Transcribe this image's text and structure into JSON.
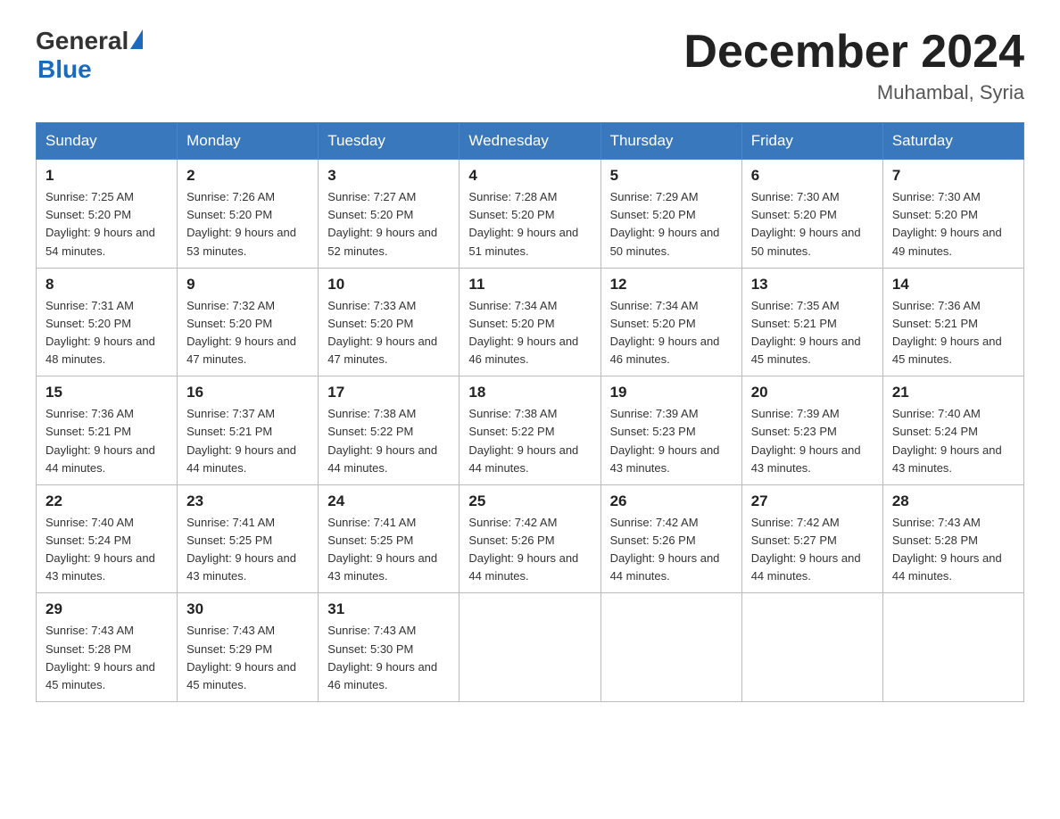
{
  "header": {
    "logo_general": "General",
    "logo_blue": "Blue",
    "month_year": "December 2024",
    "location": "Muhambal, Syria"
  },
  "days_of_week": [
    "Sunday",
    "Monday",
    "Tuesday",
    "Wednesday",
    "Thursday",
    "Friday",
    "Saturday"
  ],
  "weeks": [
    [
      {
        "day": "1",
        "sunrise": "7:25 AM",
        "sunset": "5:20 PM",
        "daylight": "9 hours and 54 minutes."
      },
      {
        "day": "2",
        "sunrise": "7:26 AM",
        "sunset": "5:20 PM",
        "daylight": "9 hours and 53 minutes."
      },
      {
        "day": "3",
        "sunrise": "7:27 AM",
        "sunset": "5:20 PM",
        "daylight": "9 hours and 52 minutes."
      },
      {
        "day": "4",
        "sunrise": "7:28 AM",
        "sunset": "5:20 PM",
        "daylight": "9 hours and 51 minutes."
      },
      {
        "day": "5",
        "sunrise": "7:29 AM",
        "sunset": "5:20 PM",
        "daylight": "9 hours and 50 minutes."
      },
      {
        "day": "6",
        "sunrise": "7:30 AM",
        "sunset": "5:20 PM",
        "daylight": "9 hours and 50 minutes."
      },
      {
        "day": "7",
        "sunrise": "7:30 AM",
        "sunset": "5:20 PM",
        "daylight": "9 hours and 49 minutes."
      }
    ],
    [
      {
        "day": "8",
        "sunrise": "7:31 AM",
        "sunset": "5:20 PM",
        "daylight": "9 hours and 48 minutes."
      },
      {
        "day": "9",
        "sunrise": "7:32 AM",
        "sunset": "5:20 PM",
        "daylight": "9 hours and 47 minutes."
      },
      {
        "day": "10",
        "sunrise": "7:33 AM",
        "sunset": "5:20 PM",
        "daylight": "9 hours and 47 minutes."
      },
      {
        "day": "11",
        "sunrise": "7:34 AM",
        "sunset": "5:20 PM",
        "daylight": "9 hours and 46 minutes."
      },
      {
        "day": "12",
        "sunrise": "7:34 AM",
        "sunset": "5:20 PM",
        "daylight": "9 hours and 46 minutes."
      },
      {
        "day": "13",
        "sunrise": "7:35 AM",
        "sunset": "5:21 PM",
        "daylight": "9 hours and 45 minutes."
      },
      {
        "day": "14",
        "sunrise": "7:36 AM",
        "sunset": "5:21 PM",
        "daylight": "9 hours and 45 minutes."
      }
    ],
    [
      {
        "day": "15",
        "sunrise": "7:36 AM",
        "sunset": "5:21 PM",
        "daylight": "9 hours and 44 minutes."
      },
      {
        "day": "16",
        "sunrise": "7:37 AM",
        "sunset": "5:21 PM",
        "daylight": "9 hours and 44 minutes."
      },
      {
        "day": "17",
        "sunrise": "7:38 AM",
        "sunset": "5:22 PM",
        "daylight": "9 hours and 44 minutes."
      },
      {
        "day": "18",
        "sunrise": "7:38 AM",
        "sunset": "5:22 PM",
        "daylight": "9 hours and 44 minutes."
      },
      {
        "day": "19",
        "sunrise": "7:39 AM",
        "sunset": "5:23 PM",
        "daylight": "9 hours and 43 minutes."
      },
      {
        "day": "20",
        "sunrise": "7:39 AM",
        "sunset": "5:23 PM",
        "daylight": "9 hours and 43 minutes."
      },
      {
        "day": "21",
        "sunrise": "7:40 AM",
        "sunset": "5:24 PM",
        "daylight": "9 hours and 43 minutes."
      }
    ],
    [
      {
        "day": "22",
        "sunrise": "7:40 AM",
        "sunset": "5:24 PM",
        "daylight": "9 hours and 43 minutes."
      },
      {
        "day": "23",
        "sunrise": "7:41 AM",
        "sunset": "5:25 PM",
        "daylight": "9 hours and 43 minutes."
      },
      {
        "day": "24",
        "sunrise": "7:41 AM",
        "sunset": "5:25 PM",
        "daylight": "9 hours and 43 minutes."
      },
      {
        "day": "25",
        "sunrise": "7:42 AM",
        "sunset": "5:26 PM",
        "daylight": "9 hours and 44 minutes."
      },
      {
        "day": "26",
        "sunrise": "7:42 AM",
        "sunset": "5:26 PM",
        "daylight": "9 hours and 44 minutes."
      },
      {
        "day": "27",
        "sunrise": "7:42 AM",
        "sunset": "5:27 PM",
        "daylight": "9 hours and 44 minutes."
      },
      {
        "day": "28",
        "sunrise": "7:43 AM",
        "sunset": "5:28 PM",
        "daylight": "9 hours and 44 minutes."
      }
    ],
    [
      {
        "day": "29",
        "sunrise": "7:43 AM",
        "sunset": "5:28 PM",
        "daylight": "9 hours and 45 minutes."
      },
      {
        "day": "30",
        "sunrise": "7:43 AM",
        "sunset": "5:29 PM",
        "daylight": "9 hours and 45 minutes."
      },
      {
        "day": "31",
        "sunrise": "7:43 AM",
        "sunset": "5:30 PM",
        "daylight": "9 hours and 46 minutes."
      },
      null,
      null,
      null,
      null
    ]
  ],
  "labels": {
    "sunrise": "Sunrise:",
    "sunset": "Sunset:",
    "daylight": "Daylight:"
  }
}
